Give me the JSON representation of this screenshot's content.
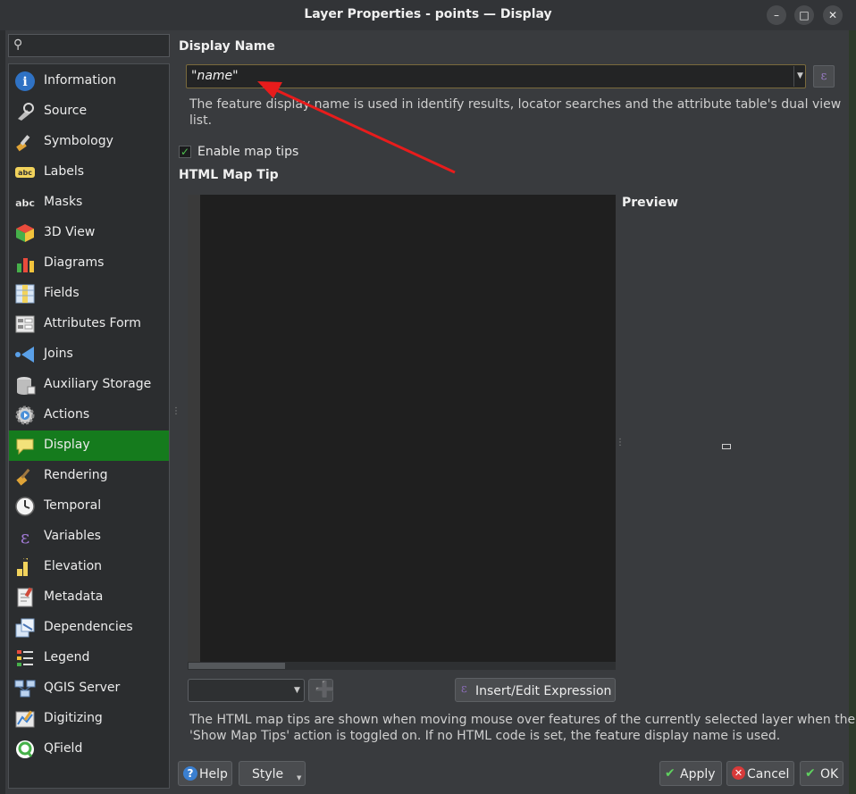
{
  "window": {
    "title": "Layer Properties - points — Display",
    "controls": [
      "minimize",
      "maximize",
      "close"
    ]
  },
  "search": {
    "value": "",
    "placeholder": ""
  },
  "sidebar": {
    "items": [
      {
        "label": "Information",
        "icon": "information-icon"
      },
      {
        "label": "Source",
        "icon": "source-icon"
      },
      {
        "label": "Symbology",
        "icon": "symbology-icon"
      },
      {
        "label": "Labels",
        "icon": "labels-icon"
      },
      {
        "label": "Masks",
        "icon": "masks-icon"
      },
      {
        "label": "3D View",
        "icon": "3d-view-icon"
      },
      {
        "label": "Diagrams",
        "icon": "diagrams-icon"
      },
      {
        "label": "Fields",
        "icon": "fields-icon"
      },
      {
        "label": "Attributes Form",
        "icon": "attributes-form-icon"
      },
      {
        "label": "Joins",
        "icon": "joins-icon"
      },
      {
        "label": "Auxiliary Storage",
        "icon": "auxiliary-storage-icon"
      },
      {
        "label": "Actions",
        "icon": "actions-icon"
      },
      {
        "label": "Display",
        "icon": "display-icon",
        "selected": true
      },
      {
        "label": "Rendering",
        "icon": "rendering-icon"
      },
      {
        "label": "Temporal",
        "icon": "temporal-icon"
      },
      {
        "label": "Variables",
        "icon": "variables-icon"
      },
      {
        "label": "Elevation",
        "icon": "elevation-icon"
      },
      {
        "label": "Metadata",
        "icon": "metadata-icon"
      },
      {
        "label": "Dependencies",
        "icon": "dependencies-icon"
      },
      {
        "label": "Legend",
        "icon": "legend-icon"
      },
      {
        "label": "QGIS Server",
        "icon": "qgis-server-icon"
      },
      {
        "label": "Digitizing",
        "icon": "digitizing-icon"
      },
      {
        "label": "QField",
        "icon": "qfield-icon"
      }
    ]
  },
  "display": {
    "display_name_label": "Display Name",
    "display_name_value": "\"name\"",
    "display_name_help": "The feature display name is used in identify results, locator searches and the attribute table's dual view",
    "display_name_help_2": "list.",
    "enable_map_tips_label": "Enable map tips",
    "enable_map_tips_checked": true,
    "html_map_tip_label": "HTML Map Tip",
    "html_map_tip_value": "",
    "preview_label": "Preview",
    "field_combo_value": "",
    "insert_expression_label": "Insert/Edit Expression",
    "map_tip_help": "The HTML map tips are shown when moving mouse over features of the currently selected layer when the",
    "map_tip_help_2": "'Show Map Tips' action is toggled on. If no HTML code is set, the feature display name is used."
  },
  "footer": {
    "help_label": "Help",
    "style_label": "Style",
    "apply_label": "Apply",
    "cancel_label": "Cancel",
    "ok_label": "OK"
  },
  "colors": {
    "selected_item": "#157b1d",
    "annotation_arrow": "#e81c1c",
    "dialog_bg": "#393b3e"
  }
}
